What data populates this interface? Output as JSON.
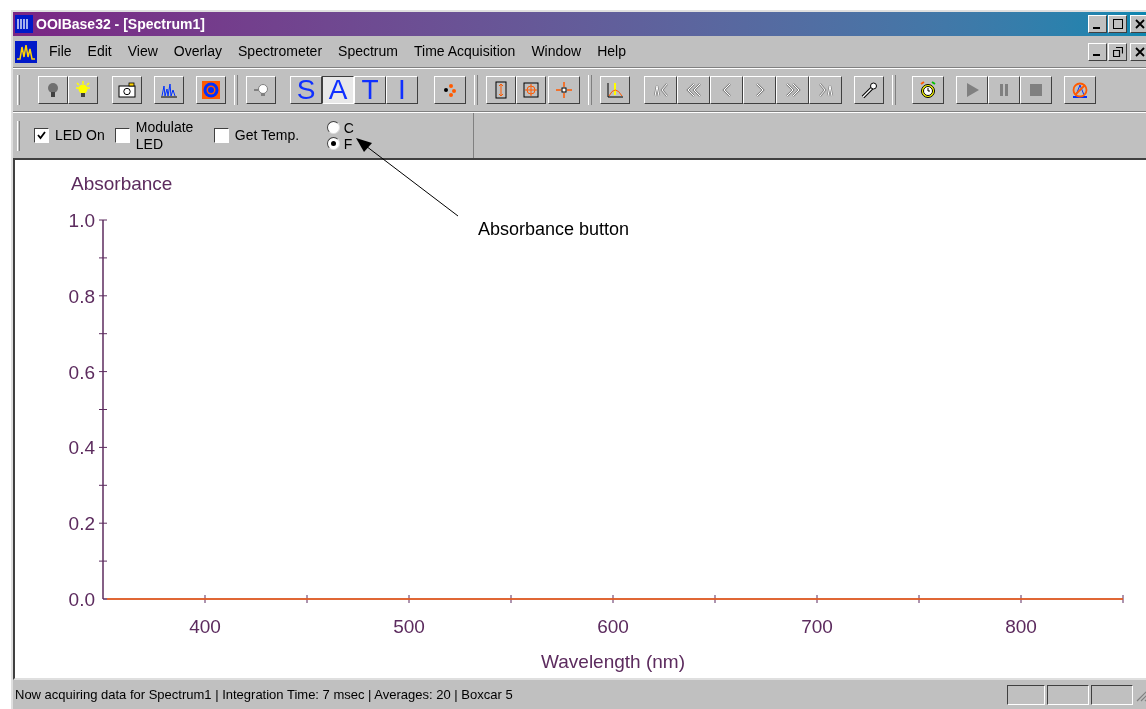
{
  "window": {
    "title": "OOIBase32 - [Spectrum1]"
  },
  "menu": [
    {
      "label": "File"
    },
    {
      "label": "Edit"
    },
    {
      "label": "View"
    },
    {
      "label": "Overlay"
    },
    {
      "label": "Spectrometer"
    },
    {
      "label": "Spectrum"
    },
    {
      "label": "Time Acquisition"
    },
    {
      "label": "Window"
    },
    {
      "label": "Help"
    }
  ],
  "mode_buttons": [
    {
      "label": "S",
      "selected": false
    },
    {
      "label": "A",
      "selected": true
    },
    {
      "label": "T",
      "selected": false
    },
    {
      "label": "I",
      "selected": false
    }
  ],
  "nav_buttons": [
    {
      "disabled": true
    },
    {
      "disabled": true
    },
    {
      "disabled": true
    },
    {
      "disabled": true
    },
    {
      "disabled": true
    },
    {
      "disabled": true
    }
  ],
  "options": {
    "checkboxes": [
      {
        "label": "LED On",
        "checked": true
      },
      {
        "label": "Modulate LED",
        "checked": false
      },
      {
        "label": "Get Temp.",
        "checked": false
      }
    ],
    "temperature_units": [
      {
        "label": "C",
        "selected": false
      },
      {
        "label": "F",
        "selected": true
      }
    ]
  },
  "chart": {
    "chart_data": {
      "type": "line",
      "xlabel": "Wavelength (nm)",
      "ylabel": "Absorbance",
      "x": [
        352,
        850
      ],
      "series": [
        {
          "color": "#ff6a1a",
          "values": [
            0,
            0
          ]
        }
      ],
      "xlim": [
        350,
        850
      ],
      "ylim": [
        0,
        1
      ],
      "xticks": [
        400,
        500,
        600,
        700,
        800
      ],
      "yticks": [
        {
          "value": 0,
          "label": "0.0"
        },
        {
          "value": 0.2,
          "label": "0.2"
        },
        {
          "value": 0.4,
          "label": "0.4"
        },
        {
          "value": 0.6,
          "label": "0.6"
        },
        {
          "value": 0.8,
          "label": "0.8"
        },
        {
          "value": 1,
          "label": "1.0"
        }
      ]
    }
  },
  "callout": {
    "text": "Absorbance button"
  },
  "status_bar": {
    "text": "Now acquiring data for Spectrum1 | Integration Time: 7 msec | Averages: 20 | Boxcar 5"
  }
}
